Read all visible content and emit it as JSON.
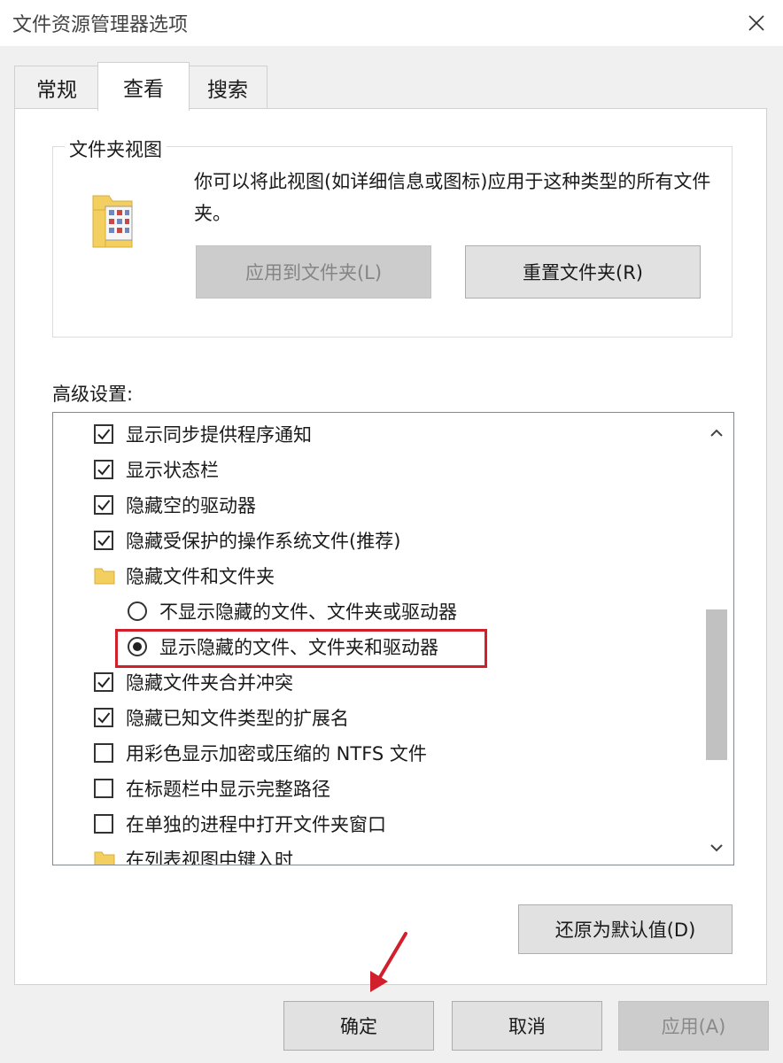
{
  "window": {
    "title": "文件资源管理器选项"
  },
  "tabs": [
    {
      "label": "常规"
    },
    {
      "label": "查看"
    },
    {
      "label": "搜索"
    }
  ],
  "folder_views": {
    "group_title": "文件夹视图",
    "description": "你可以将此视图(如详细信息或图标)应用于这种类型的所有文件夹。",
    "apply_button": "应用到文件夹(L)",
    "reset_button": "重置文件夹(R)"
  },
  "advanced": {
    "label": "高级设置:",
    "items": [
      {
        "type": "checkbox",
        "checked": true,
        "label": "显示同步提供程序通知"
      },
      {
        "type": "checkbox",
        "checked": true,
        "label": "显示状态栏"
      },
      {
        "type": "checkbox",
        "checked": true,
        "label": "隐藏空的驱动器"
      },
      {
        "type": "checkbox",
        "checked": true,
        "label": "隐藏受保护的操作系统文件(推荐)"
      },
      {
        "type": "folder",
        "label": "隐藏文件和文件夹"
      },
      {
        "type": "radio",
        "checked": false,
        "label": "不显示隐藏的文件、文件夹或驱动器"
      },
      {
        "type": "radio",
        "checked": true,
        "label": "显示隐藏的文件、文件夹和驱动器"
      },
      {
        "type": "checkbox",
        "checked": true,
        "label": "隐藏文件夹合并冲突"
      },
      {
        "type": "checkbox",
        "checked": true,
        "label": "隐藏已知文件类型的扩展名"
      },
      {
        "type": "checkbox",
        "checked": false,
        "label": "用彩色显示加密或压缩的 NTFS 文件"
      },
      {
        "type": "checkbox",
        "checked": false,
        "label": "在标题栏中显示完整路径"
      },
      {
        "type": "checkbox",
        "checked": false,
        "label": "在单独的进程中打开文件夹窗口"
      },
      {
        "type": "folder",
        "label": "在列表视图中键入时"
      }
    ],
    "restore_button": "还原为默认值(D)"
  },
  "footer": {
    "ok": "确定",
    "cancel": "取消",
    "apply": "应用(A)"
  },
  "colors": {
    "highlight_box": "#d21f2c",
    "annotation_arrow": "#d21f2c",
    "folder_yellow": "#f3cf5f"
  }
}
